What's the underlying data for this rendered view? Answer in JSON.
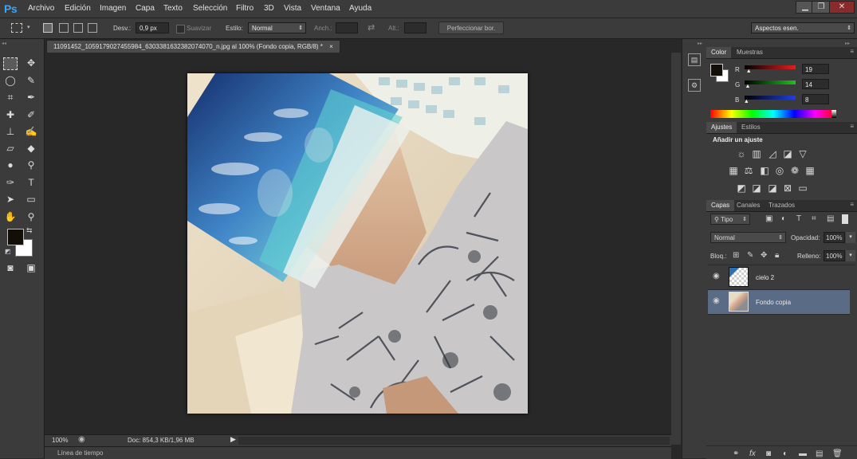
{
  "app": {
    "logo": "Ps"
  },
  "menu": [
    "Archivo",
    "Edición",
    "Imagen",
    "Capa",
    "Texto",
    "Selección",
    "Filtro",
    "3D",
    "Vista",
    "Ventana",
    "Ayuda"
  ],
  "window_controls": {
    "minimize": "▁",
    "restore": "❐",
    "close": "✕"
  },
  "options": {
    "desv_label": "Desv.:",
    "desv_value": "0,9 px",
    "suavizar_label": "Suavizar",
    "estilo_label": "Estilo:",
    "estilo_value": "Normal",
    "anch_label": "Anch.:",
    "alt_label": "Alt.:",
    "refine_button": "Perfeccionar bor.",
    "workspace": "Aspectos esen."
  },
  "document": {
    "tab_title": "11091452_1059179027455984_6303381632382074070_n.jpg al 100% (Fondo copia, RGB/8) *",
    "tab_close": "×",
    "zoom": "100%",
    "doc_info": "Doc: 854,3 KB/1,96 MB",
    "timeline_label": "Línea de tiempo"
  },
  "color_panel": {
    "tabs": [
      "Color",
      "Muestras"
    ],
    "channels": [
      {
        "name": "R",
        "value": "19",
        "fraction": 0.075,
        "color": "#e02020"
      },
      {
        "name": "G",
        "value": "14",
        "fraction": 0.055,
        "color": "#20c020"
      },
      {
        "name": "B",
        "value": "8",
        "fraction": 0.03,
        "color": "#2040e0"
      }
    ],
    "foreground": "#130e08",
    "background": "#ffffff"
  },
  "adjust_panel": {
    "tabs": [
      "Ajustes",
      "Estilos"
    ],
    "title": "Añadir un ajuste"
  },
  "layers_panel": {
    "tabs": [
      "Capas",
      "Canales",
      "Trazados"
    ],
    "filter_label": "Tipo",
    "blend_mode": "Normal",
    "opacity_label": "Opacidad:",
    "opacity_value": "100%",
    "lock_label": "Bloq.:",
    "fill_label": "Relleno:",
    "fill_value": "100%",
    "layers": [
      {
        "name": "cielo 2",
        "selected": false
      },
      {
        "name": "Fondo copia",
        "selected": true
      }
    ]
  }
}
